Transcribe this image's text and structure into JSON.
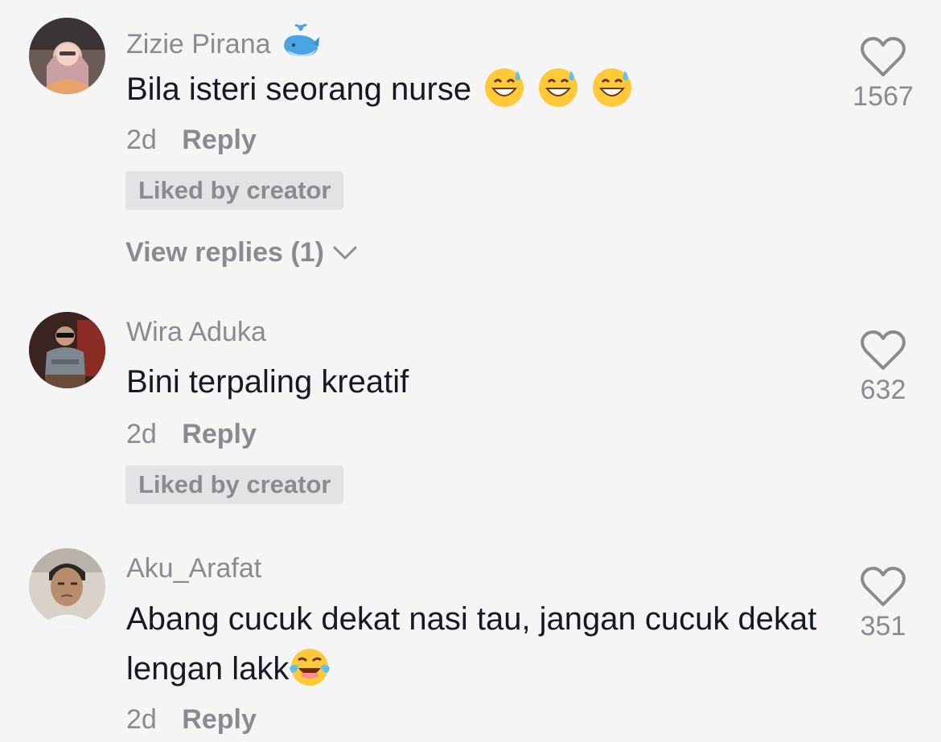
{
  "comments": [
    {
      "username": "Zizie Pirana",
      "username_emoji": "whale-emoji",
      "text": "Bila isteri seorang nurse",
      "trailing_emojis": [
        "grinning-sweat-emoji",
        "grinning-sweat-emoji",
        "grinning-sweat-emoji"
      ],
      "time": "2d",
      "reply_label": "Reply",
      "badge": "Liked by creator",
      "view_replies": "View replies (1)",
      "likes": "1567"
    },
    {
      "username": "Wira Aduka",
      "text": "Bini terpaling kreatif",
      "time": "2d",
      "reply_label": "Reply",
      "badge": "Liked by creator",
      "likes": "632"
    },
    {
      "username": "Aku_Arafat",
      "text": "Abang cucuk dekat nasi tau, jangan cucuk dekat lengan lakk",
      "trailing_emojis": [
        "tears-of-joy-emoji"
      ],
      "time": "2d",
      "reply_label": "Reply",
      "likes": "351"
    }
  ],
  "colors": {
    "background": "#f5f5f6",
    "primary_text": "#161823",
    "secondary_text": "#8a8b91",
    "badge_bg": "#e3e3e5"
  }
}
